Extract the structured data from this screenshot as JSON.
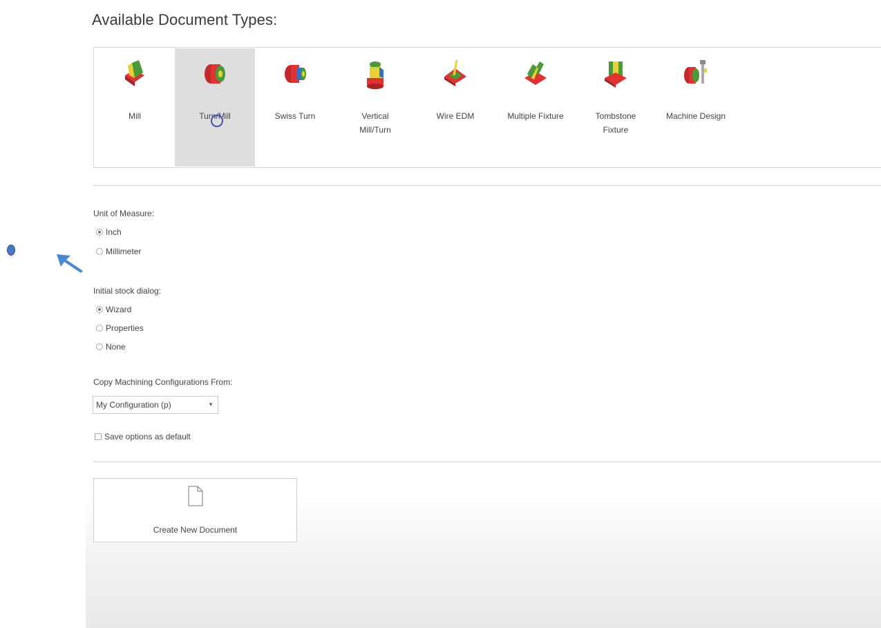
{
  "heading": "Available Document Types:",
  "document_types": [
    {
      "label": "Mill",
      "icon": "mill-icon",
      "selected": false
    },
    {
      "label": "Turn/Mill",
      "icon": "turn-mill-icon",
      "selected": true
    },
    {
      "label": "Swiss Turn",
      "icon": "swiss-turn-icon",
      "selected": false
    },
    {
      "label": "Vertical Mill/Turn",
      "icon": "vertical-mill-turn-icon",
      "selected": false
    },
    {
      "label": "Wire EDM",
      "icon": "wire-edm-icon",
      "selected": false
    },
    {
      "label": "Multiple Fixture",
      "icon": "multiple-fixture-icon",
      "selected": false
    },
    {
      "label": "Tombstone Fixture",
      "icon": "tombstone-fixture-icon",
      "selected": false
    },
    {
      "label": "Machine Design",
      "icon": "machine-design-icon",
      "selected": false
    }
  ],
  "unit_of_measure": {
    "label": "Unit of Measure:",
    "options": [
      {
        "label": "Inch",
        "checked": true
      },
      {
        "label": "Millimeter",
        "checked": false
      }
    ]
  },
  "initial_stock": {
    "label": "Initial stock dialog:",
    "options": [
      {
        "label": "Wizard",
        "checked": true
      },
      {
        "label": "Properties",
        "checked": false
      },
      {
        "label": "None",
        "checked": false
      }
    ]
  },
  "copy_config": {
    "label": "Copy Machining Configurations From:",
    "value": "My Configuration (p)"
  },
  "save_default_label": "Save options as default",
  "create_button_label": "Create New Document",
  "colors": {
    "selected_tile": "#dedede",
    "cursor_ring": "#4350b8",
    "annotation": "#4a78c4"
  }
}
